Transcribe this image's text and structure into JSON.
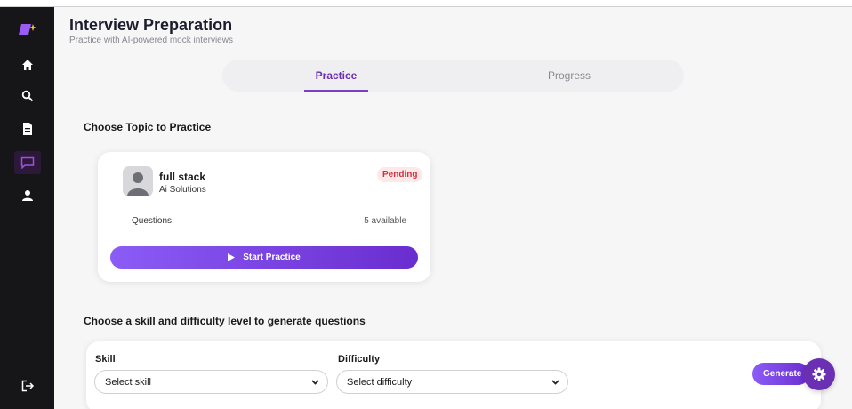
{
  "header": {
    "title": "Interview Preparation",
    "subtitle": "Practice with AI-powered mock interviews"
  },
  "tabs": [
    {
      "label": "Practice",
      "active": true
    },
    {
      "label": "Progress",
      "active": false
    }
  ],
  "sidebar": {
    "items": [
      {
        "icon": "logo-icon"
      },
      {
        "icon": "home-icon"
      },
      {
        "icon": "search-icon"
      },
      {
        "icon": "document-icon"
      },
      {
        "icon": "chat-icon",
        "active": true
      },
      {
        "icon": "user-icon"
      },
      {
        "icon": "logout-icon"
      }
    ]
  },
  "topics": {
    "title": "Choose Topic to Practice",
    "card": {
      "title": "full stack",
      "company": "Ai Solutions",
      "status": "Pending",
      "questions_label": "Questions:",
      "questions_value": "5 available",
      "button_label": "Start Practice"
    }
  },
  "generate": {
    "title": "Choose a skill and difficulty level to generate questions",
    "skill_label": "Skill",
    "skill_placeholder": "Select skill",
    "difficulty_label": "Difficulty",
    "difficulty_placeholder": "Select difficulty",
    "button_label": "Generate"
  },
  "colors": {
    "accent": "#6a2fb3",
    "sidebar_bg": "#161618",
    "badge_bg": "#fde8ea",
    "badge_text": "#d0303d"
  }
}
